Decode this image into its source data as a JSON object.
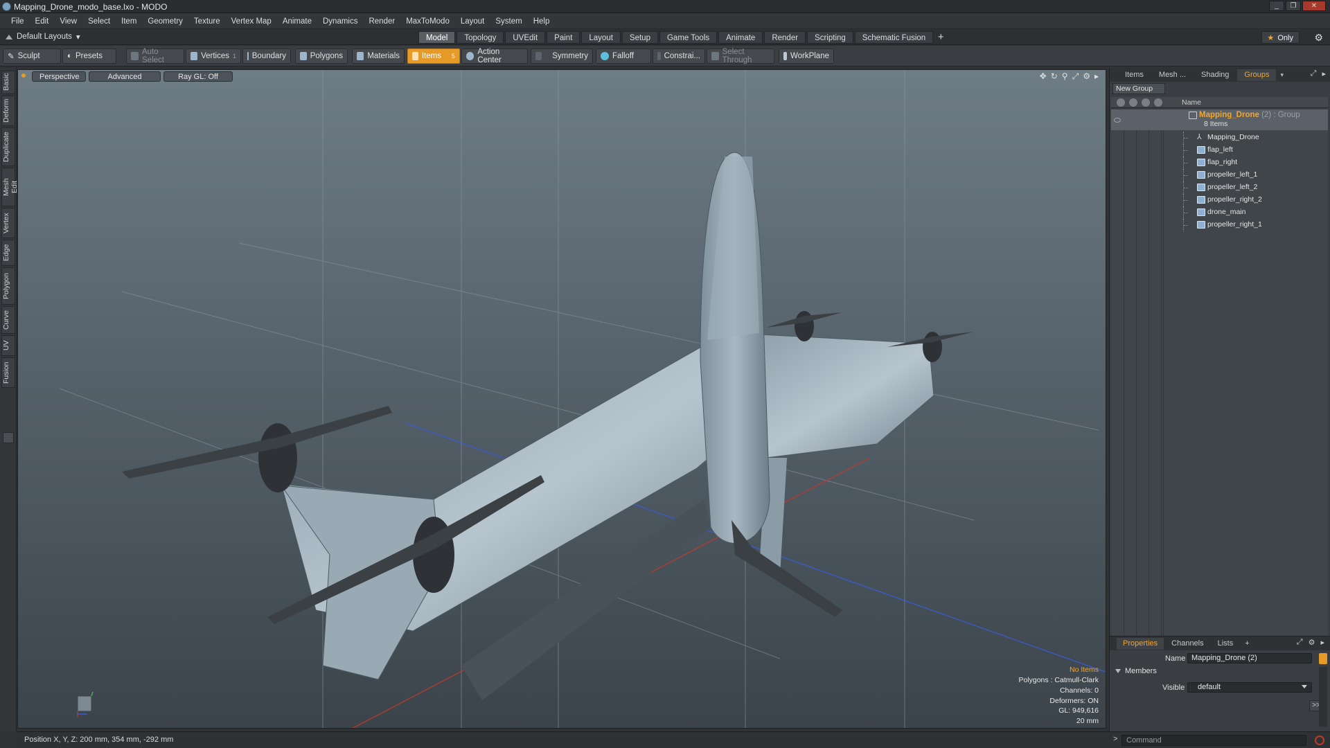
{
  "window": {
    "title": "Mapping_Drone_modo_base.lxo - MODO"
  },
  "menu": [
    "File",
    "Edit",
    "View",
    "Select",
    "Item",
    "Geometry",
    "Texture",
    "Vertex Map",
    "Animate",
    "Dynamics",
    "Render",
    "MaxToModo",
    "Layout",
    "System",
    "Help"
  ],
  "layouts": {
    "label": "Default Layouts"
  },
  "tabs": [
    "Model",
    "Topology",
    "UVEdit",
    "Paint",
    "Layout",
    "Setup",
    "Game Tools",
    "Animate",
    "Render",
    "Scripting",
    "Schematic Fusion"
  ],
  "active_tab": "Model",
  "only_label": "Only",
  "toolbar": {
    "sculpt": "Sculpt",
    "presets": "Presets",
    "auto_select": "Auto Select",
    "vertices": "Vertices",
    "vertices_count": "1",
    "boundary": "Boundary",
    "polygons": "Polygons",
    "materials": "Materials",
    "items": "Items",
    "items_count": "5",
    "action_center": "Action Center",
    "symmetry": "Symmetry",
    "falloff": "Falloff",
    "constraints": "Constrai...",
    "select_through": "Select Through",
    "workplane": "WorkPlane"
  },
  "left_tabs": [
    "Basic",
    "Deform",
    "Duplicate",
    "Mesh Edit",
    "Vertex",
    "Edge",
    "Polygon",
    "Curve",
    "UV",
    "Fusion"
  ],
  "viewport": {
    "view": "Perspective",
    "shading": "Advanced",
    "raygl": "Ray GL: Off",
    "info": {
      "no_items": "No Items",
      "polygons": "Polygons : Catmull-Clark",
      "channels": "Channels: 0",
      "deformers": "Deformers: ON",
      "gl": "GL: 949,616",
      "grid": "20 mm"
    }
  },
  "right_panel": {
    "tabs": [
      "Items",
      "Mesh ...",
      "Shading",
      "Groups"
    ],
    "active_tab": "Groups",
    "new_group": "New Group",
    "column_name": "Name",
    "group": {
      "name": "Mapping_Drone",
      "suffix": "(2) : Group",
      "count": "8 Items"
    },
    "items": [
      "Mapping_Drone",
      "flap_left",
      "flap_right",
      "propeller_left_1",
      "propeller_left_2",
      "propeller_right_2",
      "drone_main",
      "propeller_right_1"
    ]
  },
  "properties": {
    "tabs": [
      "Properties",
      "Channels",
      "Lists"
    ],
    "active_tab": "Properties",
    "name_label": "Name",
    "name_value": "Mapping_Drone (2)",
    "members_label": "Members",
    "visible_label": "Visible",
    "visible_value": "default",
    "more": ">>"
  },
  "status": {
    "position": "Position X, Y, Z:   200 mm, 354 mm, -292 mm"
  },
  "command": {
    "prompt": ">",
    "placeholder": "Command"
  },
  "colors": {
    "accent": "#e69a28",
    "group_name": "#f2a62f"
  }
}
